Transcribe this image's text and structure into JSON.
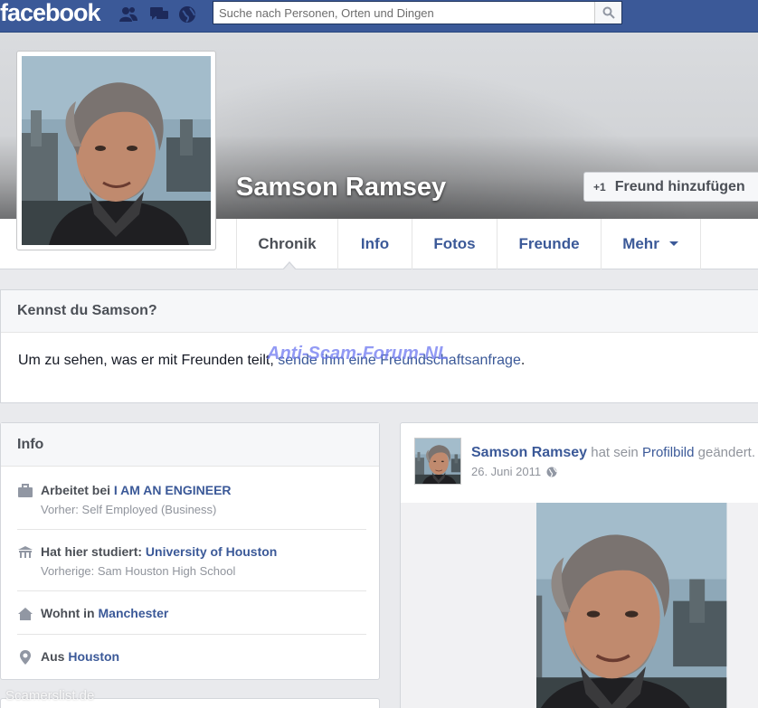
{
  "topbar": {
    "logo": "facebook",
    "search_placeholder": "Suche nach Personen, Orten und Dingen",
    "search_value": ""
  },
  "profile": {
    "name": "Samson Ramsey",
    "add_friend_label": "Freund hinzufügen"
  },
  "tabs": [
    {
      "label": "Chronik"
    },
    {
      "label": "Info"
    },
    {
      "label": "Fotos"
    },
    {
      "label": "Freunde"
    },
    {
      "label": "Mehr"
    }
  ],
  "know": {
    "title": "Kennst du Samson?",
    "text_before": "Um zu sehen, was er mit Freunden teilt, ",
    "link": "sende ihm eine Freundschaftsanfrage",
    "text_after": "."
  },
  "watermark": "Anti-Scam-Forum-NL",
  "info": {
    "title": "Info",
    "work_prefix": "Arbeitet bei ",
    "work_value": "I AM AN ENGINEER",
    "work_previous": "Vorher: Self Employed (Business)",
    "study_prefix": "Hat hier studiert: ",
    "study_value": "University of Houston",
    "study_previous": "Vorherige: Sam Houston High School",
    "lives_prefix": "Wohnt in ",
    "lives_value": "Manchester",
    "from_prefix": "Aus ",
    "from_value": "Houston"
  },
  "post": {
    "author": "Samson Ramsey",
    "action_prefix": " hat sein ",
    "action_link": "Profilbild",
    "action_suffix": " geändert.",
    "date": "26. Juni 2011"
  },
  "footer_watermark": "Scamerslist.de",
  "colors": {
    "brand": "#3b5998",
    "link": "#3b5998",
    "muted": "#90949c"
  }
}
